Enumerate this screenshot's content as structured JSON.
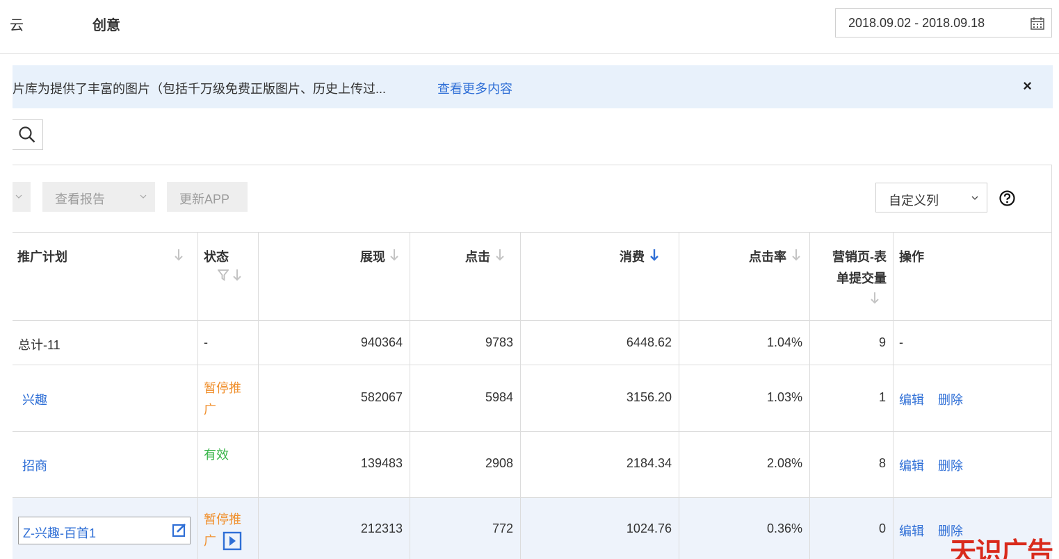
{
  "header": {
    "tab_prev": "云",
    "tab_active": "创意",
    "date_range": "2018.09.02 - 2018.09.18"
  },
  "banner": {
    "message": "片库为提供了丰富的图片（包括千万级免费正版图片、历史上传过...",
    "more_link": "查看更多内容",
    "close_label": "×"
  },
  "toolbar": {
    "report_label": "查看报告",
    "update_label": "更新APP",
    "custom_columns_label": "自定义列"
  },
  "table": {
    "headers": {
      "plan": "推广计划",
      "status": "状态",
      "impressions": "展现",
      "clicks": "点击",
      "spend": "消费",
      "ctr": "点击率",
      "forms_line1": "营销页-表",
      "forms_line2": "单提交量",
      "actions": "操作"
    },
    "total": {
      "plan": "总计-11",
      "status": "-",
      "impressions": "940364",
      "clicks": "9783",
      "spend": "6448.62",
      "ctr": "1.04%",
      "forms": "9",
      "actions": "-"
    },
    "rows": [
      {
        "plan": "兴趣",
        "status_line1": "暂停推",
        "status_line2": "广",
        "impressions": "582067",
        "clicks": "5984",
        "spend": "3156.20",
        "ctr": "1.03%",
        "forms": "1",
        "edit": "编辑",
        "delete": "删除"
      },
      {
        "plan": "招商",
        "status_line1": "有效",
        "impressions": "139483",
        "clicks": "2908",
        "spend": "2184.34",
        "ctr": "2.08%",
        "forms": "8",
        "edit": "编辑",
        "delete": "删除"
      },
      {
        "plan": "Z-兴趣-百首1",
        "status_line1": "暂停推",
        "status_line2": "广",
        "impressions": "212313",
        "clicks": "772",
        "spend": "1024.76",
        "ctr": "0.36%",
        "forms": "0",
        "edit": "编辑",
        "delete": "删除"
      }
    ]
  },
  "watermark": "天识广告",
  "colors": {
    "link": "#2f6fd6",
    "paused": "#f0902e",
    "valid": "#39b54a",
    "banner_bg": "#e8f1fb",
    "sort_active": "#2f6fd6",
    "watermark": "#d92a1c"
  }
}
